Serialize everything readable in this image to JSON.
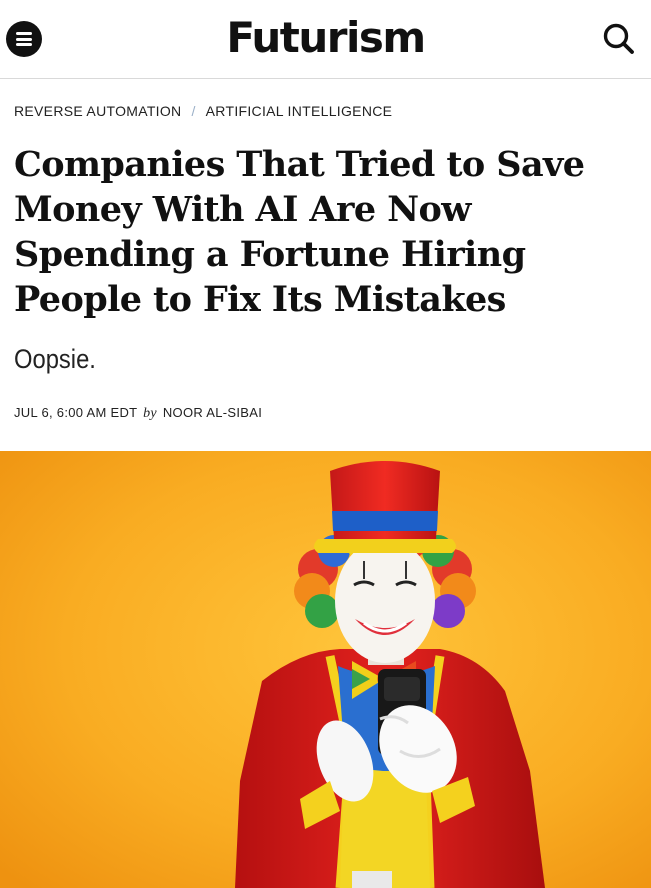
{
  "header": {
    "logo_text": "Futurism",
    "menu_icon": "hamburger-menu-icon",
    "search_icon": "search-icon"
  },
  "breadcrumb": {
    "items": [
      "REVERSE AUTOMATION",
      "ARTIFICIAL INTELLIGENCE"
    ],
    "separator": "/"
  },
  "article": {
    "headline": "Companies That Tried to Save Money With AI Are Now Spending a Fortune Hiring People to Fix Its Mistakes",
    "dek": "Oopsie.",
    "date": "JUL 6, 6:00 AM EDT",
    "by": "by",
    "author": "NOOR AL-SIBAI"
  },
  "colors": {
    "hero_background": "#f5a623",
    "text": "#111111",
    "separator": "#9bb0c8"
  }
}
